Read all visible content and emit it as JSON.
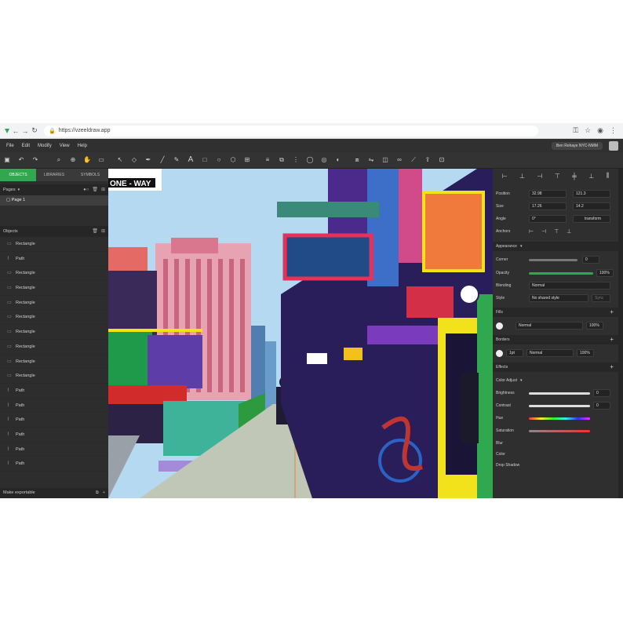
{
  "browser": {
    "url": "https://vzeeldraw.app"
  },
  "menu": {
    "items": [
      "File",
      "Edit",
      "Modify",
      "View",
      "Help"
    ],
    "user": "Ben Rehaye NYC-NMM"
  },
  "left_panel": {
    "tabs": [
      "OBJECTS",
      "LIBRARIES",
      "SYMBOLS"
    ],
    "pages_label": "Pages",
    "page_name": "Page 1",
    "objects_label": "Objects",
    "objects": [
      "Rectangle",
      "Path",
      "Rectangle",
      "Rectangle",
      "Rectangle",
      "Rectangle",
      "Rectangle",
      "Rectangle",
      "Rectangle",
      "Rectangle",
      "Path",
      "Path",
      "Path",
      "Path",
      "Path",
      "Path"
    ],
    "footer": "Make exportable"
  },
  "canvas": {
    "sign_text": "ONE - WAY"
  },
  "inspector": {
    "position_label": "Position",
    "position_x": "32.98",
    "position_y": "121.3",
    "size_label": "Size",
    "size_w": "17.26",
    "size_h": "14.2",
    "angle_label": "Angle",
    "angle_value": "0°",
    "transform_label": "transform",
    "anchors_label": "Anchors",
    "appearance_label": "Appearance",
    "corner_label": "Corner",
    "corner_value": "0",
    "opacity_label": "Opacity",
    "opacity_value": "100%",
    "blending_label": "Blending",
    "blending_value": "Normal",
    "style_label": "Style",
    "style_value": "No shared style",
    "sync_label": "Sync",
    "fills_label": "Fills",
    "fill_mode": "Normal",
    "fill_opacity": "100%",
    "borders_label": "Borders",
    "border_width": "1pt",
    "border_mode": "Normal",
    "border_opacity": "100%",
    "effects_label": "Effects",
    "color_adjust_label": "Color Adjust",
    "brightness_label": "Brightness",
    "brightness_value": "0",
    "contrast_label": "Contrast",
    "contrast_value": "0",
    "hue_label": "Hue",
    "saturation_label": "Saturation",
    "blur_label": "Blur",
    "color_label": "Color",
    "drop_shadow_label": "Drop Shadow"
  },
  "colors": {
    "accent": "#2fa84f",
    "panel": "#2d2d2d",
    "canvas_sky": "#b6d9f2"
  }
}
